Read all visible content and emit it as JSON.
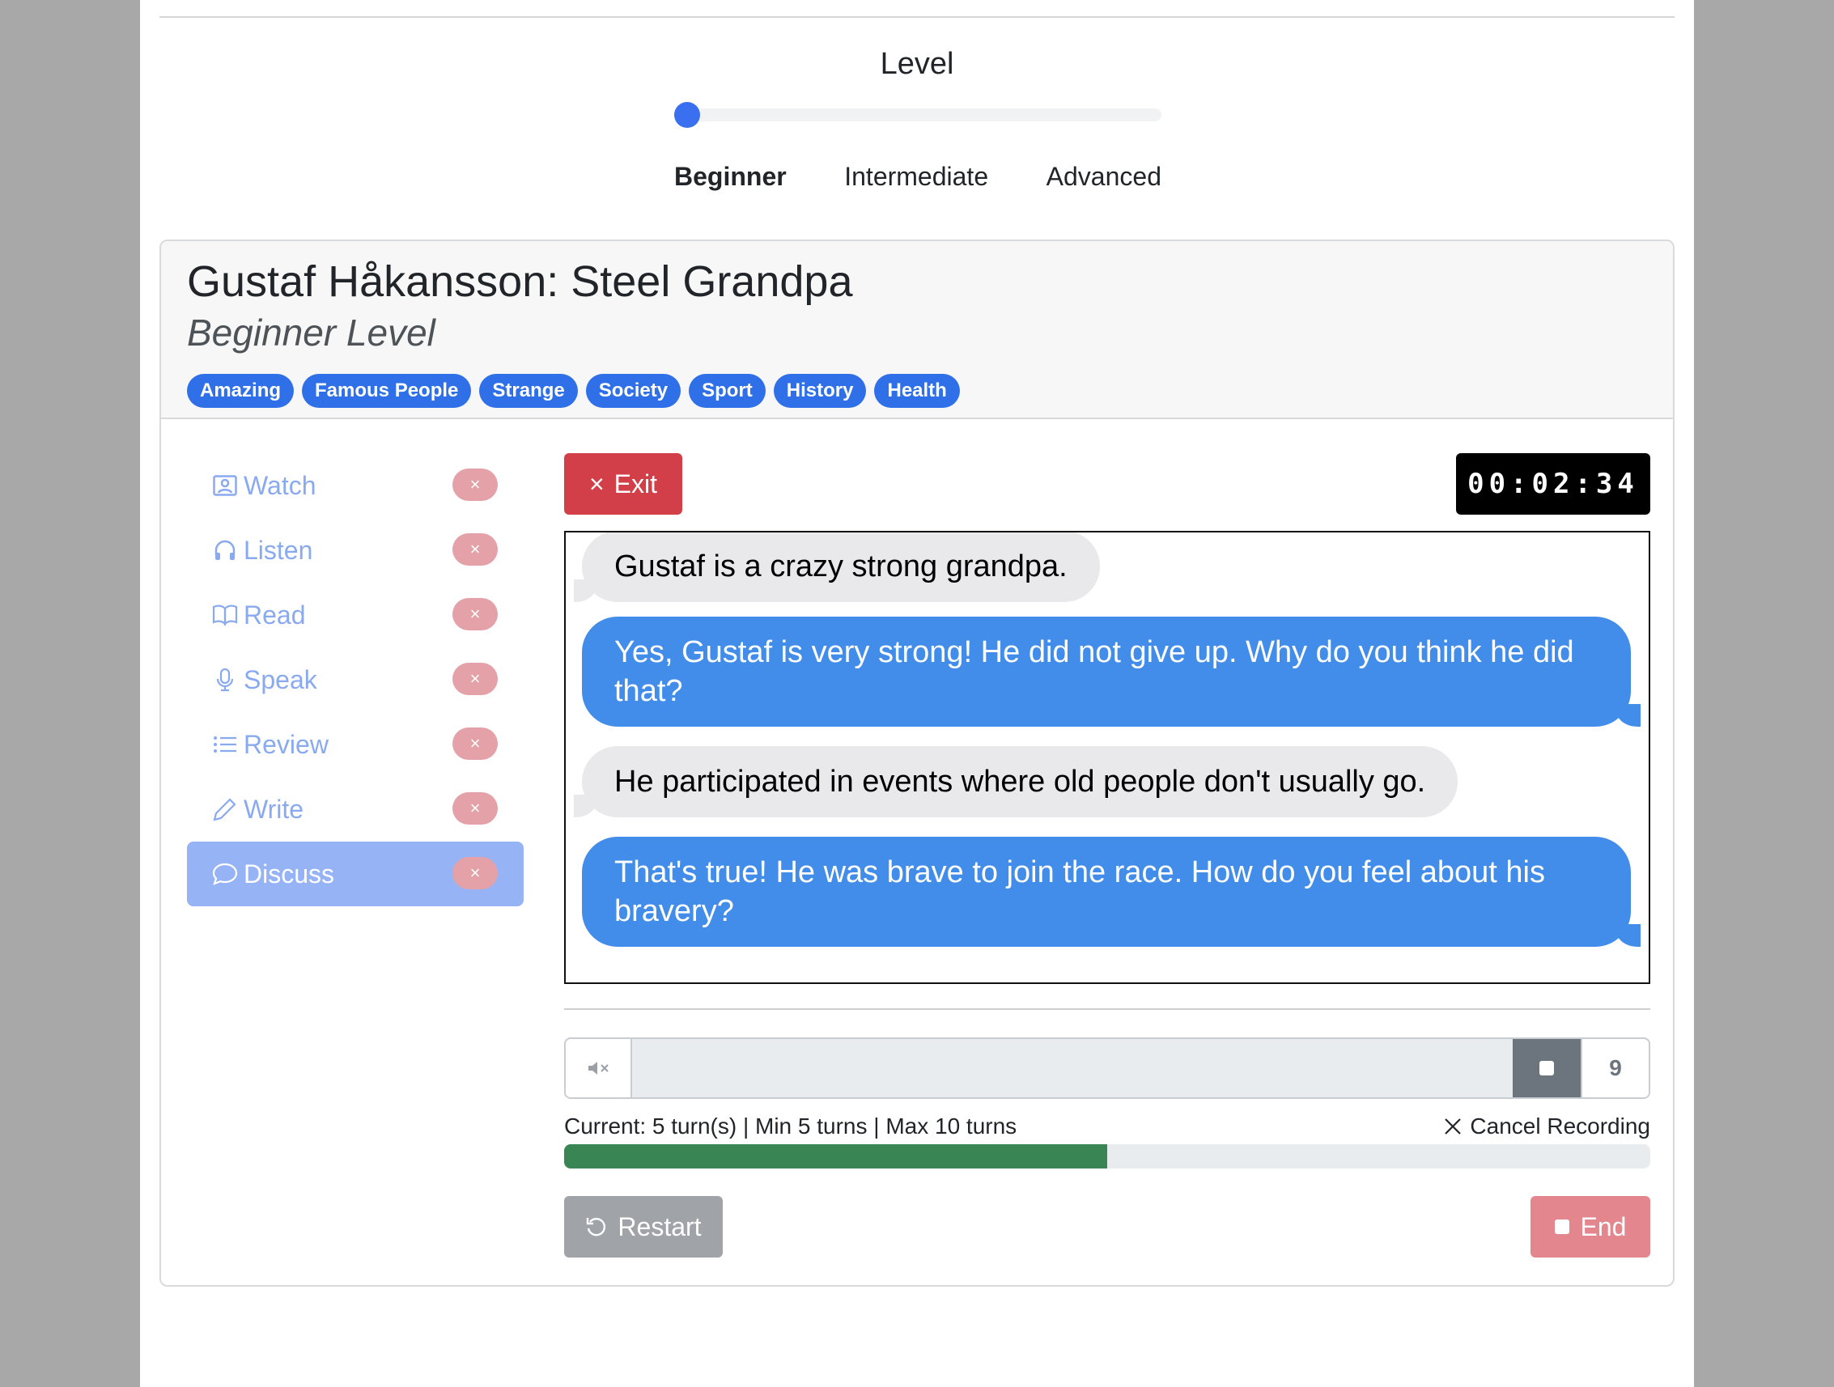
{
  "level": {
    "heading": "Level",
    "options": [
      "Beginner",
      "Intermediate",
      "Advanced"
    ],
    "selected_index": 0,
    "slider_value_fraction": 0.0
  },
  "lesson": {
    "title": "Gustaf Håkansson: Steel Grandpa",
    "subtitle": "Beginner Level",
    "tags": [
      "Amazing",
      "Famous People",
      "Strange",
      "Society",
      "Sport",
      "History",
      "Health"
    ]
  },
  "sidebar": {
    "items": [
      {
        "label": "Watch",
        "icon": "person-video-icon",
        "badge": "×"
      },
      {
        "label": "Listen",
        "icon": "headphones-icon",
        "badge": "×"
      },
      {
        "label": "Read",
        "icon": "book-icon",
        "badge": "×"
      },
      {
        "label": "Speak",
        "icon": "microphone-icon",
        "badge": "×"
      },
      {
        "label": "Review",
        "icon": "list-icon",
        "badge": "×"
      },
      {
        "label": "Write",
        "icon": "pencil-icon",
        "badge": "×"
      },
      {
        "label": "Discuss",
        "icon": "chat-bubble-icon",
        "badge": "×"
      }
    ],
    "active_index": 6
  },
  "toolbar": {
    "exit_label": "Exit",
    "exit_icon": "×",
    "timer": "00:02:34"
  },
  "chat": {
    "messages": [
      {
        "from": "user",
        "text": "Gustaf is a crazy strong grandpa."
      },
      {
        "from": "bot",
        "text": "Yes, Gustaf is very strong! He did not give up. Why do you think he did that?"
      },
      {
        "from": "user",
        "text": "He participated in events where old people don't usually go."
      },
      {
        "from": "bot",
        "text": "That's true! He was brave to join the race. How do you feel about his bravery?"
      }
    ]
  },
  "recorder": {
    "mute_icon": "speaker-muted-icon",
    "count": "9"
  },
  "turns": {
    "status": "Current: 5 turn(s) | Min 5 turns | Max 10 turns",
    "cancel_label": "Cancel Recording",
    "progress_fraction": 0.5
  },
  "actions": {
    "restart_label": "Restart",
    "end_label": "End"
  },
  "colors": {
    "accent": "#2f6fe8",
    "bot_bubble": "#428cea",
    "user_bubble": "#e9e9eb",
    "exit": "#d23f49",
    "progress": "#3a8554"
  }
}
